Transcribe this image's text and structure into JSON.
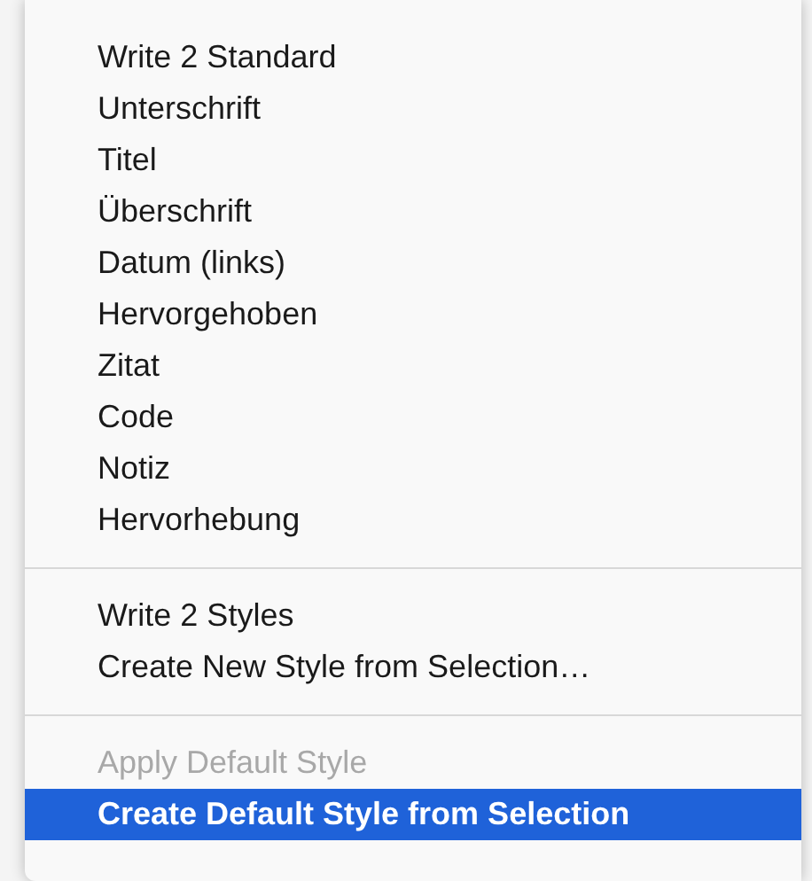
{
  "menu": {
    "sections": [
      {
        "items": [
          {
            "label": "Write 2 Standard",
            "disabled": false,
            "selected": false
          },
          {
            "label": "Unterschrift",
            "disabled": false,
            "selected": false
          },
          {
            "label": "Titel",
            "disabled": false,
            "selected": false
          },
          {
            "label": "Überschrift",
            "disabled": false,
            "selected": false
          },
          {
            "label": "Datum (links)",
            "disabled": false,
            "selected": false
          },
          {
            "label": "Hervorgehoben",
            "disabled": false,
            "selected": false
          },
          {
            "label": "Zitat",
            "disabled": false,
            "selected": false
          },
          {
            "label": "Code",
            "disabled": false,
            "selected": false
          },
          {
            "label": "Notiz",
            "disabled": false,
            "selected": false
          },
          {
            "label": "Hervorhebung",
            "disabled": false,
            "selected": false
          }
        ]
      },
      {
        "items": [
          {
            "label": "Write 2 Styles",
            "disabled": false,
            "selected": false
          },
          {
            "label": "Create New Style from Selection…",
            "disabled": false,
            "selected": false
          }
        ]
      },
      {
        "items": [
          {
            "label": "Apply Default Style",
            "disabled": true,
            "selected": false
          },
          {
            "label": "Create Default Style from Selection",
            "disabled": false,
            "selected": true
          }
        ]
      }
    ]
  }
}
